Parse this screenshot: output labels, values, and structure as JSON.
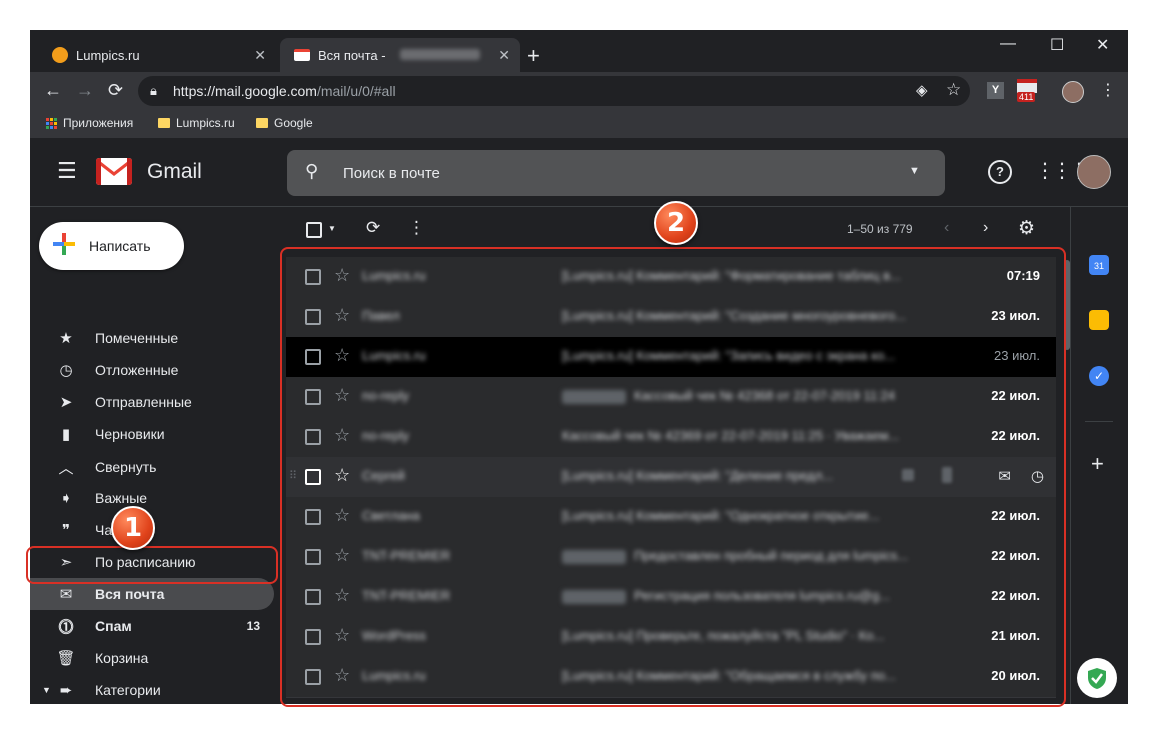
{
  "browser": {
    "tabs": [
      {
        "label": "Lumpics.ru",
        "favicon_color": "#f29d1b"
      },
      {
        "label": "Вся почта -",
        "favicon_color": "#ea4335"
      }
    ],
    "new_tab": "+",
    "window_controls": {
      "minimize": "—",
      "maximize": "☐",
      "close": "✕"
    },
    "url_host": "https://mail.google.com",
    "url_path": "/mail/u/0/#all",
    "extensions": {
      "y_badge": "Y",
      "mail_count": "411"
    },
    "bookmarks": [
      {
        "label": "Приложения"
      },
      {
        "label": "Lumpics.ru"
      },
      {
        "label": "Google"
      }
    ]
  },
  "gmail": {
    "logo_text": "Gmail",
    "search_placeholder": "Поиск в почте",
    "compose_label": "Написать",
    "nav": [
      {
        "label": "Помеченные",
        "icon": "star-icon"
      },
      {
        "label": "Отложенные",
        "icon": "clock-icon"
      },
      {
        "label": "Отправленные",
        "icon": "send-icon"
      },
      {
        "label": "Черновики",
        "icon": "draft-icon"
      },
      {
        "label": "Свернуть",
        "icon": "chevron-up-icon"
      },
      {
        "label": "Важные",
        "icon": "important-icon"
      },
      {
        "label": "Чаты",
        "icon": "chat-icon"
      },
      {
        "label": "По расписанию",
        "icon": "scheduled-icon"
      },
      {
        "label": "Вся почта",
        "icon": "mail-icon"
      },
      {
        "label": "Спам",
        "icon": "spam-icon",
        "count": "13"
      },
      {
        "label": "Корзина",
        "icon": "trash-icon"
      },
      {
        "label": "Категории",
        "icon": "label-icon"
      }
    ],
    "pagination": "1–50 из 779",
    "emails": [
      {
        "sender": "Lumpics.ru",
        "subject": "[Lumpics.ru] Комментарий: \"Форматирование таблиц в...",
        "date": "07:19"
      },
      {
        "sender": "Павел",
        "subject": "[Lumpics.ru] Комментарий: \"Создание многоуровневого...",
        "date": "23 июл."
      },
      {
        "sender": "Lumpics.ru",
        "subject": "[Lumpics.ru] Комментарий: \"Запись видео с экрана ко...",
        "date": "23 июл."
      },
      {
        "sender": "no-reply",
        "subject": "Кассовый чек № 42368 от 22-07-2019 11:24",
        "date": "22 июл.",
        "tag": true
      },
      {
        "sender": "no-reply",
        "subject": "Кассовый чек № 42369 от 22-07-2019 11:25 · Уважаем...",
        "date": "22 июл."
      },
      {
        "sender": "Сергей",
        "subject": "[Lumpics.ru] Комментарий: \"Деление предл...",
        "date": ""
      },
      {
        "sender": "Светлана",
        "subject": "[Lumpics.ru] Комментарий: \"Однократное открытие...",
        "date": "22 июл."
      },
      {
        "sender": "TNT-PREMIER",
        "subject": "Предоставлен пробный период для lumpics...",
        "date": "22 июл.",
        "tag": true
      },
      {
        "sender": "TNT-PREMIER",
        "subject": "Регистрация пользователя lumpics.ru@g...",
        "date": "22 июл.",
        "tag": true
      },
      {
        "sender": "WordPress",
        "subject": "[Lumpics.ru] Проверьте, пожалуйста \"PL Studio\" · Ко...",
        "date": "21 июл."
      },
      {
        "sender": "Lumpics.ru",
        "subject": "[Lumpics.ru] Комментарий: \"Обращаемся в службу по...",
        "date": "20 июл."
      }
    ]
  },
  "annotations": {
    "bubble1": "1",
    "bubble2": "2",
    "highlight_color": "#d93025"
  }
}
